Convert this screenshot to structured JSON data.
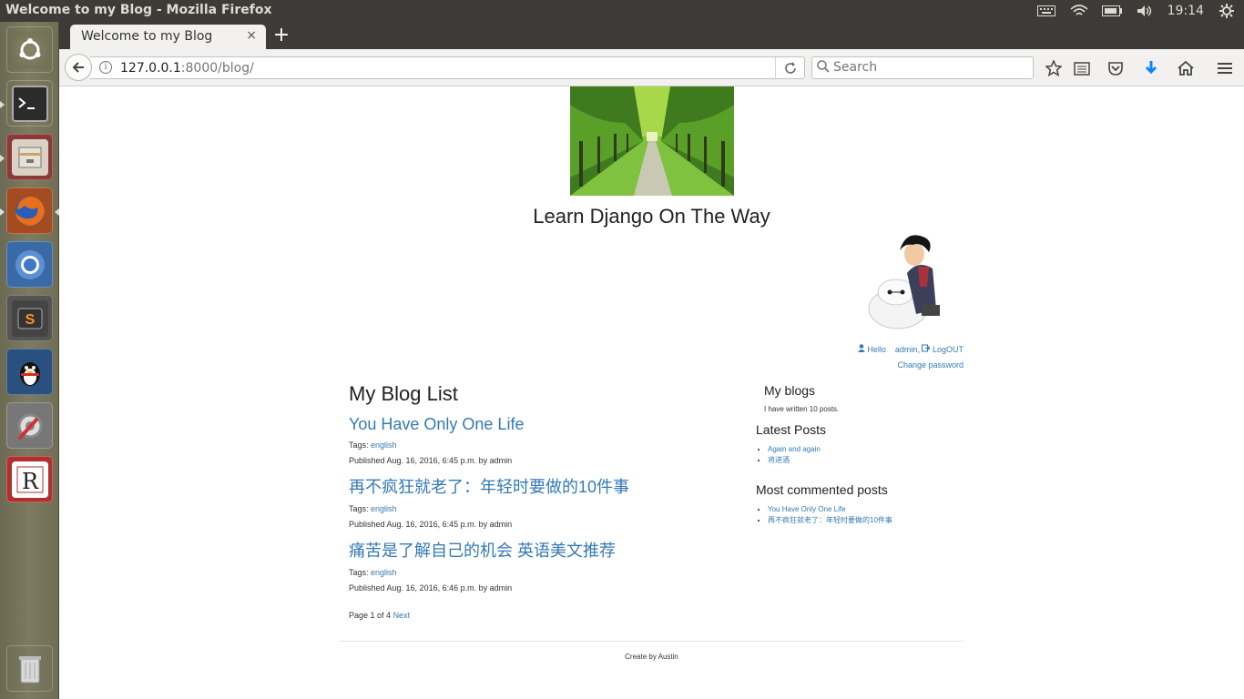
{
  "window": {
    "title": "Welcome to my Blog - Mozilla Firefox",
    "clock": "19:14"
  },
  "browser": {
    "tab_title": "Welcome to my Blog",
    "tab_close": "×",
    "new_tab": "+",
    "url_host": "127.0.0.1",
    "url_rest": ":8000/blog/",
    "search_placeholder": "Search"
  },
  "site": {
    "title": "Learn Django On The Way",
    "user": {
      "hello": "Hello",
      "username": "admin",
      "logout": "LogOUT",
      "change_password": "Change password"
    }
  },
  "main": {
    "heading": "My Blog List",
    "posts": [
      {
        "title": "You Have Only One Life",
        "tags_label": "Tags:",
        "tag": "english",
        "published": "Published Aug. 16, 2016, 6:45 p.m. by admin"
      },
      {
        "title": "再不疯狂就老了：年轻时要做的10件事",
        "tags_label": "Tags:",
        "tag": "english",
        "published": "Published Aug. 16, 2016, 6:45 p.m. by admin"
      },
      {
        "title": "痛苦是了解自己的机会 英语美文推荐",
        "tags_label": "Tags:",
        "tag": "english",
        "published": "Published Aug. 16, 2016, 6:46 p.m. by admin"
      }
    ],
    "pager_text": "Page 1 of 4",
    "pager_next": "Next"
  },
  "sidebar": {
    "my_blogs_heading": "My blogs",
    "post_count_text": "I have written 10 posts.",
    "latest_heading": "Latest Posts",
    "latest": [
      "Again and again",
      "将进酒"
    ],
    "most_commented_heading": "Most commented posts",
    "most_commented": [
      "You Have Only One Life",
      "再不疯狂就老了：年轻时要做的10件事"
    ]
  },
  "footer": {
    "text": "Create by Austin"
  },
  "colors": {
    "link": "#337ab7",
    "chrome_dark": "#3c3b37",
    "chrome_light": "#f2f1f0"
  }
}
